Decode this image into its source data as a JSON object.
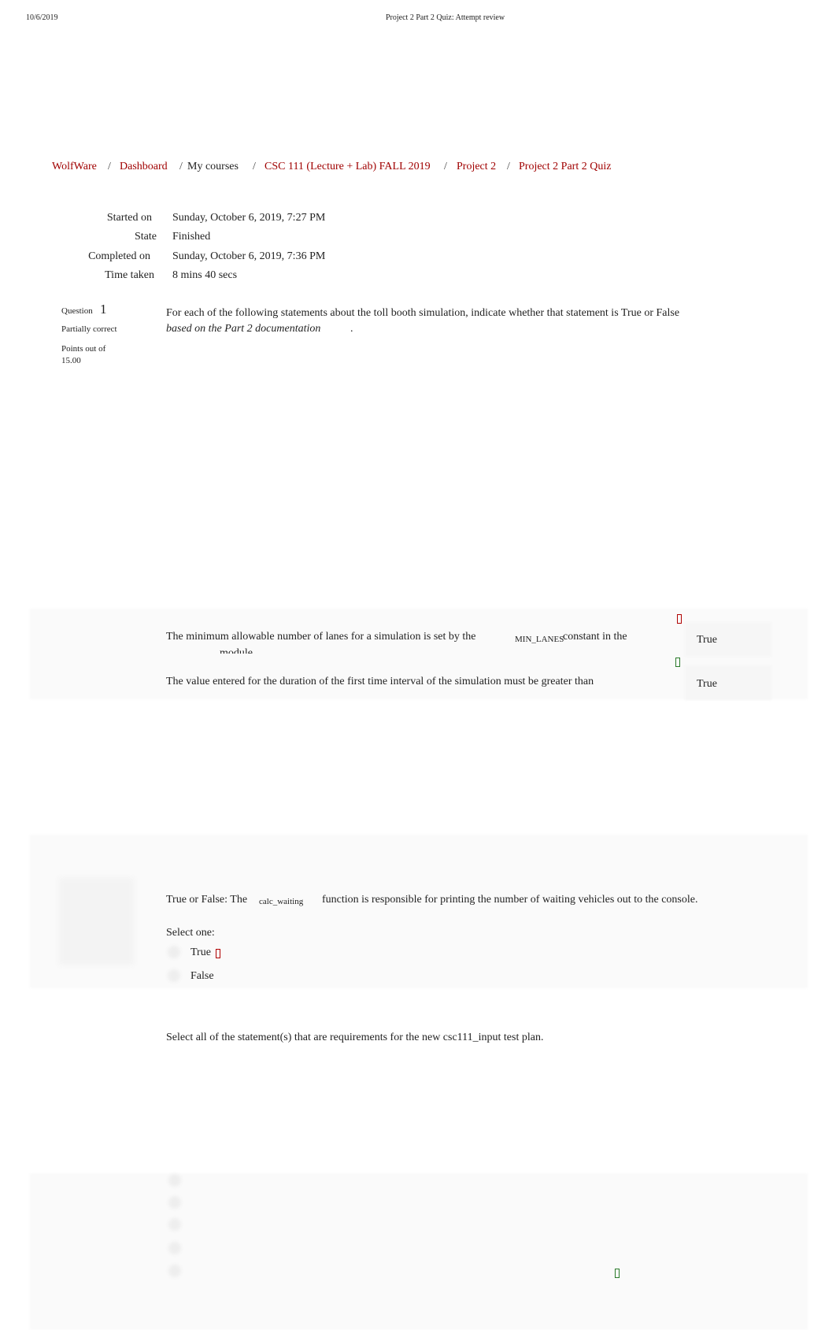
{
  "print_header": {
    "date": "10/6/2019",
    "title": "Project 2 Part 2 Quiz: Attempt review"
  },
  "breadcrumb": [
    {
      "label": "WolfWare",
      "link": true
    },
    {
      "label": "Dashboard",
      "link": true
    },
    {
      "label": "My courses",
      "link": false
    },
    {
      "label": "CSC 111 (Lecture + Lab) FALL 2019",
      "link": true
    },
    {
      "label": "Project 2",
      "link": true
    },
    {
      "label": "Project 2 Part 2 Quiz",
      "link": true
    }
  ],
  "summary": [
    {
      "label": "Started on",
      "value": "Sunday, October 6, 2019, 7:27 PM"
    },
    {
      "label": "State",
      "value": "Finished"
    },
    {
      "label": "Completed on",
      "value": "Sunday, October 6, 2019, 7:36 PM"
    },
    {
      "label": "Time taken",
      "value": "8 mins 40 secs"
    }
  ],
  "question1": {
    "label": "Question",
    "number": "1",
    "status": "Partially correct",
    "points": "Points out of",
    "points_value": "15.00",
    "prompt": "For each of the following statements about the toll booth simulation, indicate whether that statement is True or False",
    "prompt_emph": "based on the Part 2 documentation",
    "prompt_end": ".",
    "statements": [
      {
        "text_a": "The minimum allowable number of lanes for a simulation is set by the",
        "code": "MIN_LANES",
        "text_b": "constant in the",
        "text_c": "module",
        "answer": "True",
        "mark": "incorrect"
      },
      {
        "text_a": "The value entered for the duration of the first time interval of the simulation must be greater than",
        "answer": "True",
        "mark": "correct"
      }
    ]
  },
  "question_tf": {
    "text_a": "True or False: The",
    "code": "calc_waiting",
    "text_b": "function is responsible for printing the number of waiting vehicles out to the console.",
    "select_label": "Select one:",
    "options": [
      {
        "label": "True",
        "mark": "incorrect"
      },
      {
        "label": "False"
      }
    ]
  },
  "question_multi": {
    "prompt": "Select all of the statement(s) that are requirements for the new csc111_input test plan."
  },
  "colors": {
    "link": "#a00000",
    "incorrect": "#b00000",
    "correct": "#2a7a2a"
  }
}
